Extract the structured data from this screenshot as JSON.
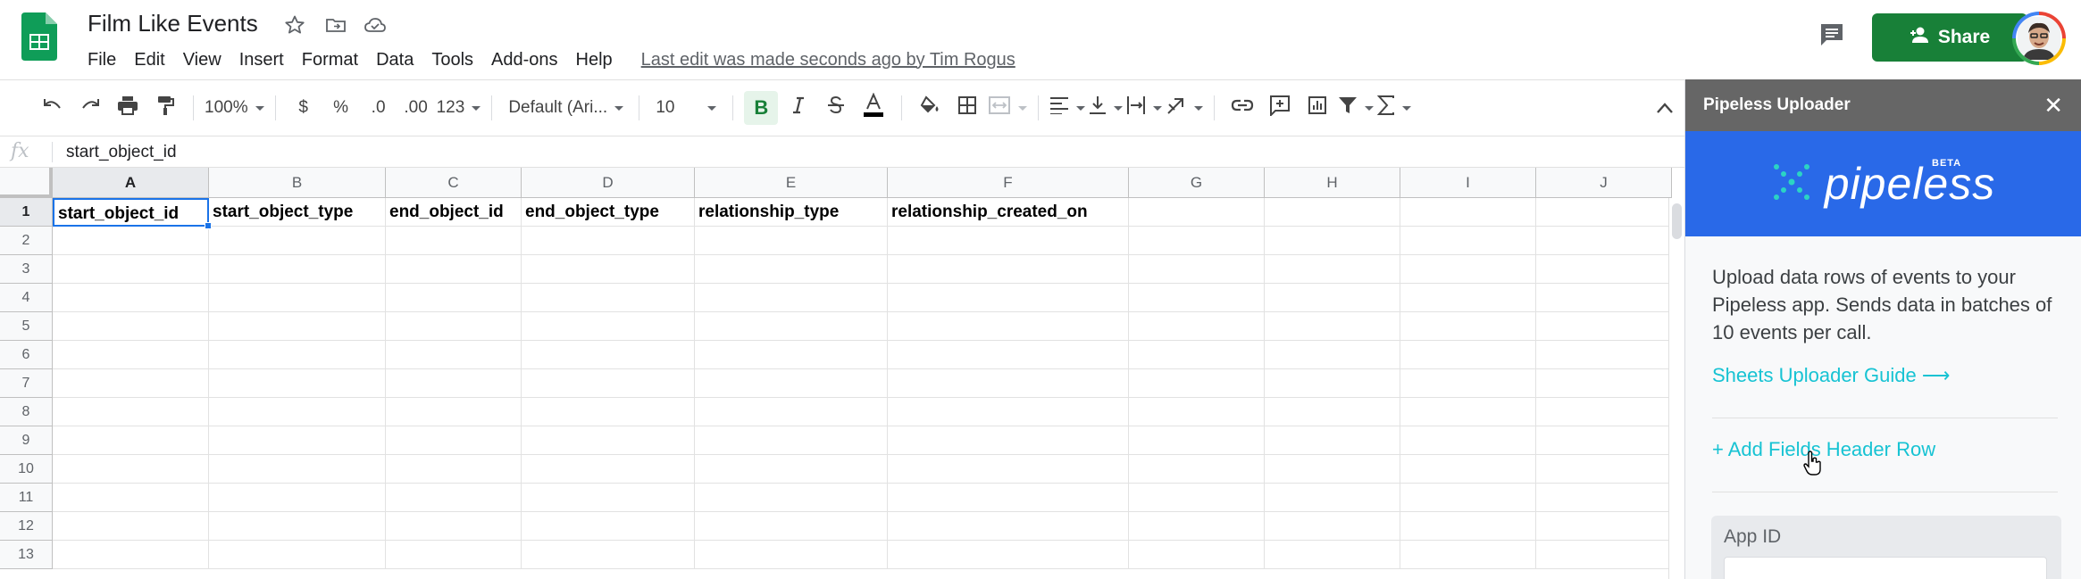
{
  "header": {
    "title": "Film Like Events",
    "menu": [
      "File",
      "Edit",
      "View",
      "Insert",
      "Format",
      "Data",
      "Tools",
      "Add-ons",
      "Help"
    ],
    "last_edit": "Last edit was made seconds ago by Tim Rogus",
    "share_label": "Share"
  },
  "toolbar": {
    "zoom": "100%",
    "currency": "$",
    "percent": "%",
    "dec_decrease": ".0",
    "dec_increase": ".00",
    "more_formats": "123",
    "font": "Default (Ari...",
    "font_size": "10",
    "bold": "B"
  },
  "formula_bar": {
    "fx": "fx",
    "value": "start_object_id"
  },
  "grid": {
    "columns": [
      "A",
      "B",
      "C",
      "D",
      "E",
      "F",
      "G",
      "H",
      "I",
      "J"
    ],
    "rows": [
      "1",
      "2",
      "3",
      "4",
      "5",
      "6",
      "7",
      "8",
      "9",
      "10",
      "11",
      "12",
      "13"
    ],
    "row1": [
      "start_object_id",
      "start_object_type",
      "end_object_id",
      "end_object_type",
      "relationship_type",
      "relationship_created_on",
      "",
      "",
      "",
      ""
    ],
    "active_cell": "A1"
  },
  "panel": {
    "title": "Pipeless Uploader",
    "close": "✕",
    "brand": "pipeless",
    "beta": "BETA",
    "description": "Upload data rows of events to your Pipeless app. Sends data in batches of 10 events per call.",
    "guide_link": "Sheets Uploader Guide ⟶",
    "add_header_link": "+ Add Fields Header Row",
    "app_id_label": "App ID",
    "app_id_value": ""
  },
  "colors": {
    "share_green": "#188038",
    "panel_blue": "#2969e8",
    "link_teal": "#17c3d3",
    "selection_blue": "#1a73e8"
  },
  "icons": [
    "sheets-logo-icon",
    "star-icon",
    "move-folder-icon",
    "cloud-saved-icon",
    "comment-icon",
    "person-add-icon",
    "undo-icon",
    "redo-icon",
    "print-icon",
    "paint-format-icon",
    "text-color-icon",
    "fill-color-icon",
    "borders-icon",
    "merge-icon",
    "align-left-icon",
    "valign-icon",
    "wrap-icon",
    "rotate-icon",
    "link-icon",
    "insert-comment-icon",
    "insert-chart-icon",
    "filter-icon",
    "functions-icon",
    "collapse-icon",
    "pipeless-logo-icon",
    "hand-cursor-icon"
  ]
}
